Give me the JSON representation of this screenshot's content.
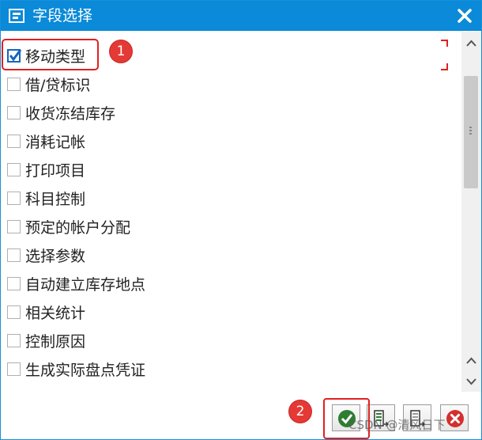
{
  "window": {
    "title": "字段选择",
    "close_label": "×"
  },
  "fields": [
    {
      "label": "移动类型",
      "checked": true
    },
    {
      "label": "借/贷标识",
      "checked": false
    },
    {
      "label": "收货冻结库存",
      "checked": false
    },
    {
      "label": "消耗记帐",
      "checked": false
    },
    {
      "label": "打印项目",
      "checked": false
    },
    {
      "label": "科目控制",
      "checked": false
    },
    {
      "label": "预定的帐户分配",
      "checked": false
    },
    {
      "label": "选择参数",
      "checked": false
    },
    {
      "label": "自动建立库存地点",
      "checked": false
    },
    {
      "label": "相关统计",
      "checked": false
    },
    {
      "label": "控制原因",
      "checked": false
    },
    {
      "label": "生成实际盘点凭证",
      "checked": false
    }
  ],
  "annotations": {
    "badge_1": "1",
    "badge_2": "2"
  },
  "footer": {
    "buttons": [
      {
        "icon": "confirm-check-icon"
      },
      {
        "icon": "select-all-icon"
      },
      {
        "icon": "deselect-all-icon"
      },
      {
        "icon": "cancel-icon"
      }
    ]
  },
  "watermark": "CSDN @清风日下",
  "colors": {
    "titlebar": "#0a8ad8",
    "annotation": "#e53935",
    "confirm": "#2e7d32",
    "cancel": "#d32f2f"
  }
}
